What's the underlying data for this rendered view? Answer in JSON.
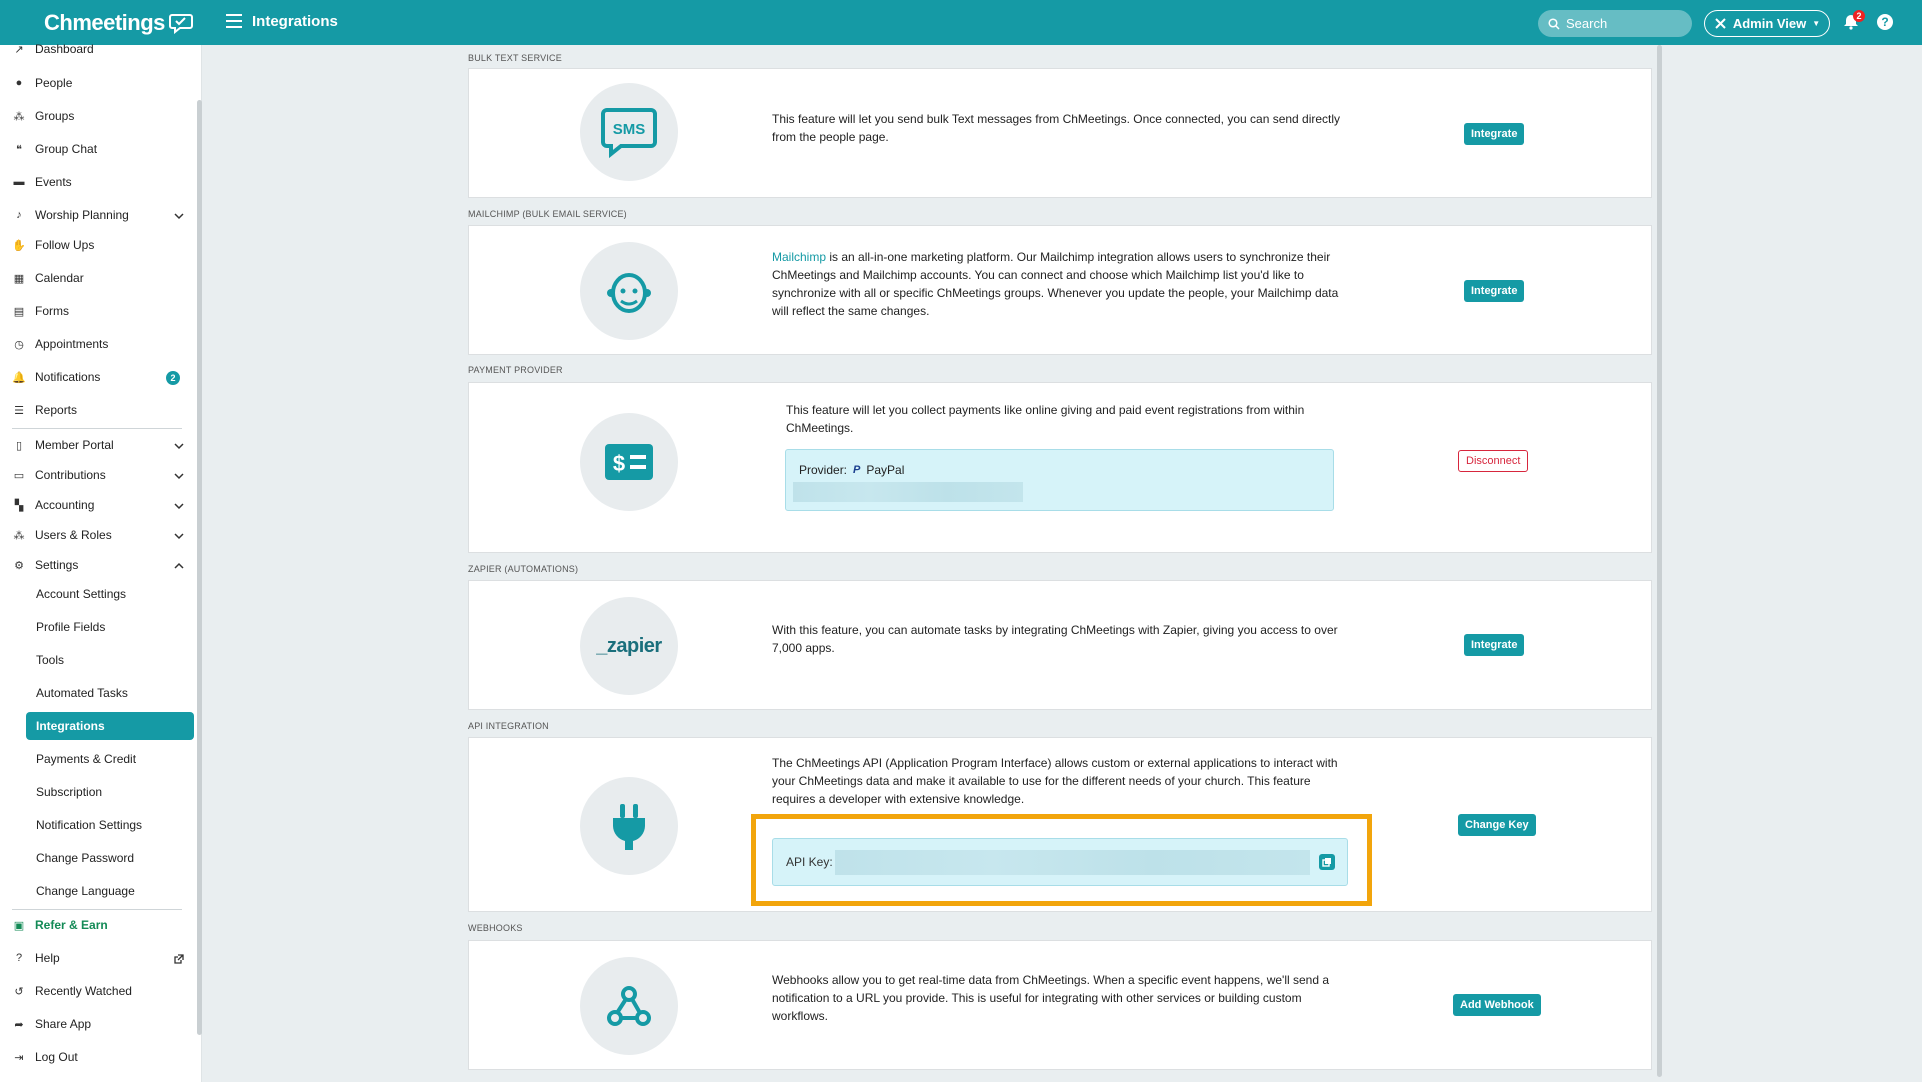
{
  "topbar": {
    "brand": "Chmeetings",
    "title": "Integrations",
    "search_placeholder": "Search",
    "admin_view": "Admin View",
    "notification_count": "2",
    "help_icon": "?"
  },
  "sidebar": {
    "items": [
      {
        "label": "Dashboard",
        "icon": "chart-icon"
      },
      {
        "label": "People",
        "icon": "person-icon"
      },
      {
        "label": "Groups",
        "icon": "groups-icon"
      },
      {
        "label": "Group Chat",
        "icon": "chat-icon"
      },
      {
        "label": "Events",
        "icon": "events-icon"
      },
      {
        "label": "Worship Planning",
        "icon": "music-icon"
      },
      {
        "label": "Follow Ups",
        "icon": "handshake-icon"
      },
      {
        "label": "Calendar",
        "icon": "calendar-icon"
      },
      {
        "label": "Forms",
        "icon": "forms-icon"
      },
      {
        "label": "Appointments",
        "icon": "clock-icon"
      },
      {
        "label": "Notifications",
        "icon": "bell-icon",
        "badge": "2"
      },
      {
        "label": "Reports",
        "icon": "reports-icon"
      },
      {
        "label": "Member Portal",
        "icon": "mobile-icon"
      },
      {
        "label": "Contributions",
        "icon": "money-icon"
      },
      {
        "label": "Accounting",
        "icon": "accounting-icon"
      },
      {
        "label": "Users & Roles",
        "icon": "users-icon"
      },
      {
        "label": "Settings",
        "icon": "gear-icon"
      }
    ],
    "settings_sub": [
      "Account Settings",
      "Profile Fields",
      "Tools",
      "Automated Tasks",
      "Integrations",
      "Payments & Credit",
      "Subscription",
      "Notification Settings",
      "Change Password",
      "Change Language"
    ],
    "bottom": [
      {
        "label": "Refer & Earn",
        "icon": "gift-icon"
      },
      {
        "label": "Help",
        "icon": "question-icon"
      },
      {
        "label": "Recently Watched",
        "icon": "history-icon"
      },
      {
        "label": "Share App",
        "icon": "share-icon"
      },
      {
        "label": "Log Out",
        "icon": "logout-icon"
      }
    ]
  },
  "sections": {
    "sms": {
      "label": "BULK TEXT SERVICE",
      "icon_text": "SMS",
      "desc": "This feature will let you send bulk Text messages from ChMeetings. Once connected, you can send directly from the people page.",
      "button": "Integrate"
    },
    "mailchimp": {
      "label": "MAILCHIMP (BULK EMAIL SERVICE)",
      "link": "Mailchimp",
      "desc": " is an all-in-one marketing platform. Our Mailchimp integration allows users to synchronize their ChMeetings and Mailchimp accounts. You can connect and choose which Mailchimp list you'd like to synchronize with all or specific ChMeetings groups. Whenever you update the people, your Mailchimp data will reflect the same changes.",
      "button": "Integrate"
    },
    "payment": {
      "label": "PAYMENT PROVIDER",
      "desc": "This feature will let you collect payments like online giving and paid event registrations from within ChMeetings.",
      "provider_label": "Provider:",
      "provider_name": "PayPal",
      "button": "Disconnect"
    },
    "zapier": {
      "label": "ZAPIER (AUTOMATIONS)",
      "icon_text": "_zapier",
      "desc": "With this feature, you can automate tasks by integrating ChMeetings with Zapier, giving you access to over 7,000 apps.",
      "button": "Integrate"
    },
    "api": {
      "label": "API INTEGRATION",
      "desc": "The ChMeetings API (Application Program Interface) allows custom or external applications to interact with your ChMeetings data and make it available to use for the different needs of your church. This feature requires a developer with extensive knowledge.",
      "key_label": "API Key:",
      "button": "Change Key"
    },
    "webhooks": {
      "label": "WEBHOOKS",
      "desc": "Webhooks allow you to get real-time data from ChMeetings. When a specific event happens, we'll send a notification to a URL you provide. This is useful for integrating with other services or building custom workflows.",
      "button": "Add Webhook"
    }
  },
  "colors": {
    "brand": "#159aa5",
    "highlight": "#f2a50c",
    "danger": "#d7263d",
    "refer": "#138a56"
  }
}
